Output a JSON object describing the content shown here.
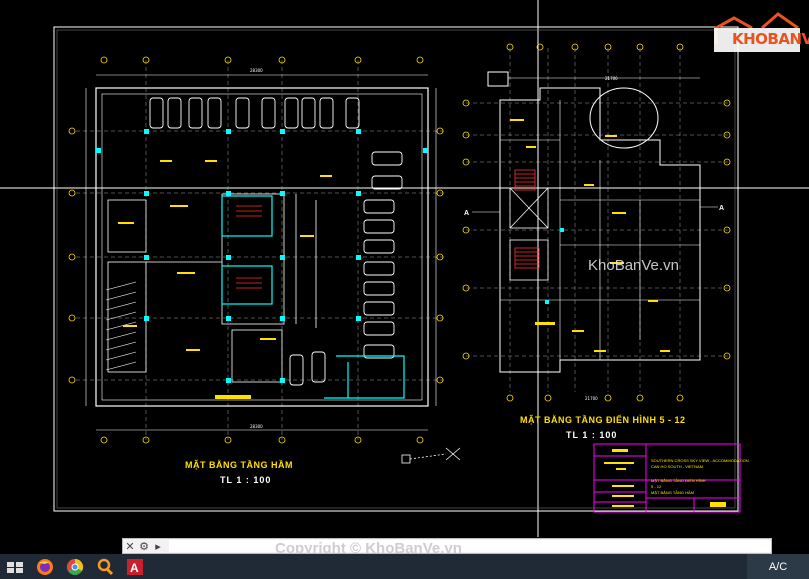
{
  "app": {
    "name": "AutoCAD",
    "layout_tab": "A/C"
  },
  "logo": {
    "text": "KHOBANVE"
  },
  "drawings": {
    "left_title": "MẶT BẰNG TẦNG HẦM",
    "left_scale": "TL 1 : 100",
    "right_title": "MẶT BẰNG TẦNG ĐIỂN HÌNH 5 - 12",
    "right_scale": "TL 1 : 100",
    "section_mark_left": "A",
    "section_mark_right": "A"
  },
  "watermark": {
    "text": "KhoBanVe.vn"
  },
  "copyright": {
    "text": "Copyright © KhoBanVe.vn"
  },
  "title_block": {
    "line1": "SOUTHERN CROSS SKY VIEW - ACCOMMODATION",
    "line2": "CAN HO SOUTH - VIETNAM",
    "line3": "MẶT BẰNG TẦNG ĐIỂN HÌNH",
    "line4": "5 - 12",
    "line5": "MẶT BẰNG TẦNG HẦM"
  },
  "command_line": {
    "placeholder": ""
  },
  "taskbar": {
    "icons": [
      "start-icon",
      "firefox-icon",
      "chrome-icon",
      "search-icon",
      "autocad-icon"
    ]
  },
  "colors": {
    "accent": "#ffe000",
    "cyan": "#00ffff",
    "magenta": "#ff00ff",
    "background": "#000000"
  }
}
